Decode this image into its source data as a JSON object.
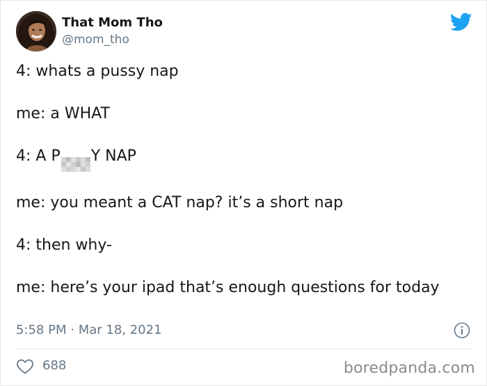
{
  "author": {
    "display_name": "That Mom Tho",
    "handle": "@mom_tho"
  },
  "tweet": {
    "line1": "4: whats a pussy nap",
    "line2": "me: a WHAT",
    "line3_prefix": "4: A P",
    "line3_suffix": "Y NAP",
    "line4": "me: you meant a CAT nap? it’s a short nap",
    "line5": "4: then why-",
    "line6": "me: here’s your ipad that’s enough questions for today"
  },
  "meta": {
    "timestamp": "5:58 PM · Mar 18, 2021",
    "like_count": "688"
  },
  "watermark": "boredpanda.com",
  "icons": {
    "brand": "twitter-bird-icon",
    "info": "info-icon",
    "like": "heart-icon"
  },
  "colors": {
    "twitter_blue": "#1da1f2",
    "secondary_text": "#657786",
    "primary_text": "#14171a",
    "divider": "#e1e8ed"
  }
}
